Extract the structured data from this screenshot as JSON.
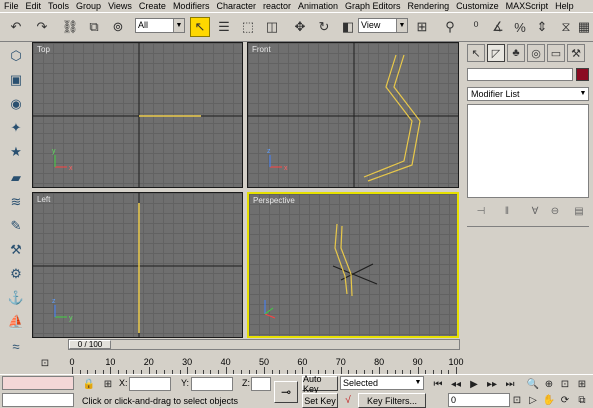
{
  "menu": [
    "File",
    "Edit",
    "Tools",
    "Group",
    "Views",
    "Create",
    "Modifiers",
    "Character",
    "reactor",
    "Animation",
    "Graph Editors",
    "Rendering",
    "Customize",
    "MAXScript",
    "Help"
  ],
  "toolbar": {
    "selection_filter": "All",
    "reference_coord": "View",
    "icons": [
      "undo-icon",
      "redo-icon",
      "select-link-icon",
      "unlink-icon",
      "bind-space-warp-icon",
      "select-object-icon",
      "select-by-name-icon",
      "rectangular-selection-icon",
      "window-crossing-icon",
      "select-move-icon",
      "select-rotate-icon",
      "select-scale-icon",
      "pivot-center-icon",
      "select-manipulate-icon",
      "snaps-icon",
      "angle-snap-icon",
      "percent-snap-icon",
      "spinner-snap-icon",
      "named-selection-icon",
      "mirror-icon",
      "align-icon",
      "layer-manager-icon",
      "curve-editor-icon",
      "material-editor-icon",
      "render-scene-icon",
      "quick-render-icon"
    ]
  },
  "left_toolbar_icons": [
    "create-objects-icon",
    "box-icon",
    "sphere-icon",
    "light-icon",
    "star-icon",
    "camera-icon",
    "stack-icon",
    "paint-icon",
    "bone-icon",
    "gear-icon",
    "link-icon",
    "walkthrough-icon",
    "wave-icon"
  ],
  "viewports": {
    "top": "Top",
    "front": "Front",
    "left": "Left",
    "perspective": "Perspective"
  },
  "command_panel": {
    "tabs": [
      "create-tab-icon",
      "modify-tab-icon",
      "hierarchy-tab-icon",
      "motion-tab-icon",
      "display-tab-icon",
      "utilities-tab-icon"
    ],
    "object_color": "#8b0b22",
    "modifier_list": "Modifier List"
  },
  "time_slider": {
    "frame_label": "0 / 100",
    "ticks": [
      "0",
      "10",
      "20",
      "30",
      "40",
      "50",
      "60",
      "70",
      "80",
      "90",
      "100"
    ]
  },
  "status": {
    "x_label": "X:",
    "y_label": "Y:",
    "z_label": "Z:",
    "auto_key": "Auto Key",
    "set_key": "Set Key",
    "selected": "Selected",
    "key_filters": "Key Filters...",
    "prompt": "Click or click-and-drag to select objects",
    "frame_value": "0"
  },
  "colors": {
    "viewport_bg": "#6f6f6f",
    "active_border": "#e6e000",
    "object_line": "#e8c84a",
    "ui_bg": "#d4d0c8"
  }
}
